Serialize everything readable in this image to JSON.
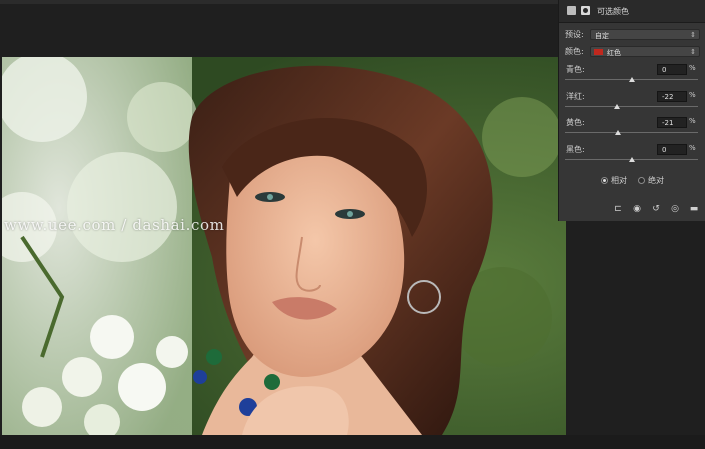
{
  "watermark": "www.uee.com / dashai.com",
  "panel": {
    "title": "可选颜色",
    "preset_label": "预设:",
    "preset_value": "自定",
    "colors_label": "颜色:",
    "colors_value": "红色",
    "swatch_color": "#c0281e",
    "sliders": [
      {
        "label": "青色:",
        "value": "0",
        "unit": "%",
        "level": 0
      },
      {
        "label": "洋红:",
        "value": "-22",
        "unit": "%",
        "level": -22
      },
      {
        "label": "黄色:",
        "value": "-21",
        "unit": "%",
        "level": -21
      },
      {
        "label": "黑色:",
        "value": "0",
        "unit": "%",
        "level": 0
      }
    ],
    "method": {
      "relative_label": "相对",
      "absolute_label": "绝对",
      "selected": "relative"
    },
    "footer_icons": [
      "clip-to-layer-icon",
      "view-previous-icon",
      "reset-icon",
      "visibility-icon",
      "delete-icon"
    ]
  }
}
